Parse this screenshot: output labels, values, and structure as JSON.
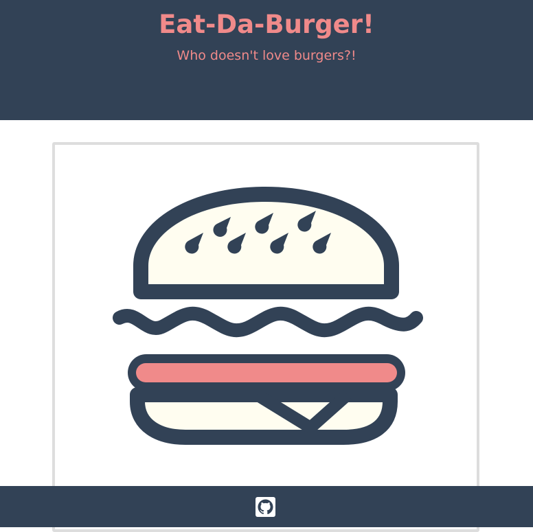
{
  "header": {
    "title": "Eat-Da-Burger!",
    "subtitle": "Who doesn't love burgers?!"
  },
  "colors": {
    "header_bg": "#324256",
    "accent": "#F08A8A",
    "bun": "#FFFDF0",
    "outline": "#324256"
  },
  "hero": {
    "image": "burger-illustration"
  },
  "footer": {
    "icon": "github-icon"
  }
}
